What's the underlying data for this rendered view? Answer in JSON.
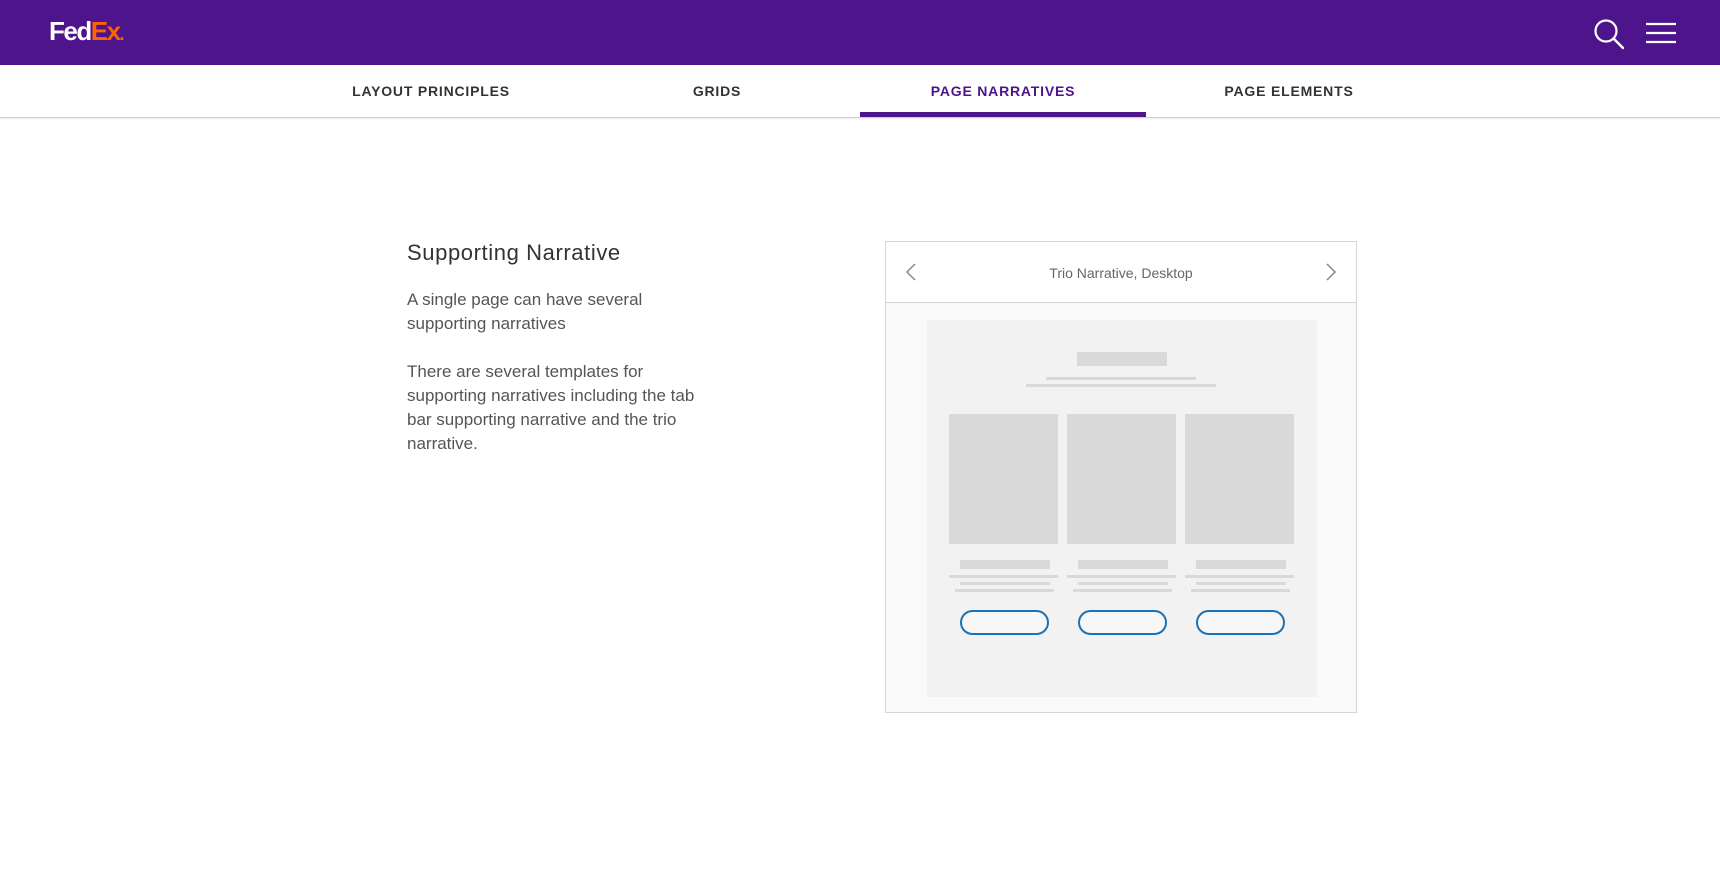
{
  "header": {
    "logo": {
      "fed": "Fed",
      "ex": "Ex",
      "dot": "."
    },
    "search_icon": "search-icon",
    "menu_icon": "hamburger-menu-icon"
  },
  "tabs": [
    {
      "label": "LAYOUT PRINCIPLES",
      "active": false
    },
    {
      "label": "GRIDS",
      "active": false
    },
    {
      "label": "PAGE NARRATIVES",
      "active": true
    },
    {
      "label": "PAGE ELEMENTS",
      "active": false
    }
  ],
  "content": {
    "title": "Supporting Narrative",
    "paragraph1": "A single page can have several supporting narratives",
    "paragraph2": "There are several templates for supporting narratives including the tab bar supporting narrative and the trio narrative."
  },
  "carousel": {
    "title": "Trio Narrative, Desktop",
    "prev_icon": "chevron-left-icon",
    "next_icon": "chevron-right-icon"
  },
  "colors": {
    "brand_purple": "#4d148c",
    "brand_orange": "#ff6200",
    "button_outline": "#1a73b8"
  }
}
